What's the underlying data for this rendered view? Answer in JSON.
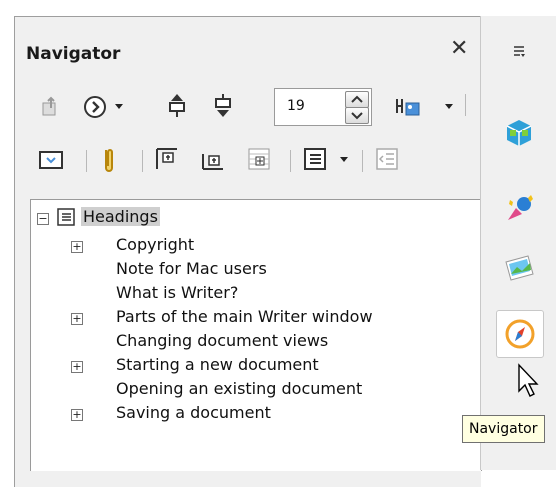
{
  "panel": {
    "title": "Navigator",
    "close_glyph": "✕",
    "spin_value": "19"
  },
  "toolbar_row1": [
    "toggle-icon",
    "navigate-by-icon",
    "promote-chapter-icon",
    "demote-chapter-icon",
    "heading-level-spinner",
    "drag-mode-icon"
  ],
  "toolbar_row2": [
    "content-view-icon",
    "reminder-icon",
    "header-icon",
    "footer-icon",
    "anchor-icon",
    "heading-levels-icon",
    "demote-level-icon"
  ],
  "tree": {
    "root": "Headings",
    "items": [
      {
        "label": "Copyright",
        "expandable": true
      },
      {
        "label": "Note for Mac users",
        "expandable": false
      },
      {
        "label": "What is Writer?",
        "expandable": false
      },
      {
        "label": "Parts of the main Writer window",
        "expandable": true
      },
      {
        "label": "Changing document views",
        "expandable": false
      },
      {
        "label": "Starting a new document",
        "expandable": true
      },
      {
        "label": "Opening an existing document",
        "expandable": false
      },
      {
        "label": "Saving a document",
        "expandable": true
      }
    ]
  },
  "deck": {
    "menu_icon": "more-options-icon",
    "buttons": [
      "properties-icon",
      "styles-icon",
      "gallery-icon",
      "navigator-compass-icon"
    ]
  },
  "tooltip": "Navigator"
}
